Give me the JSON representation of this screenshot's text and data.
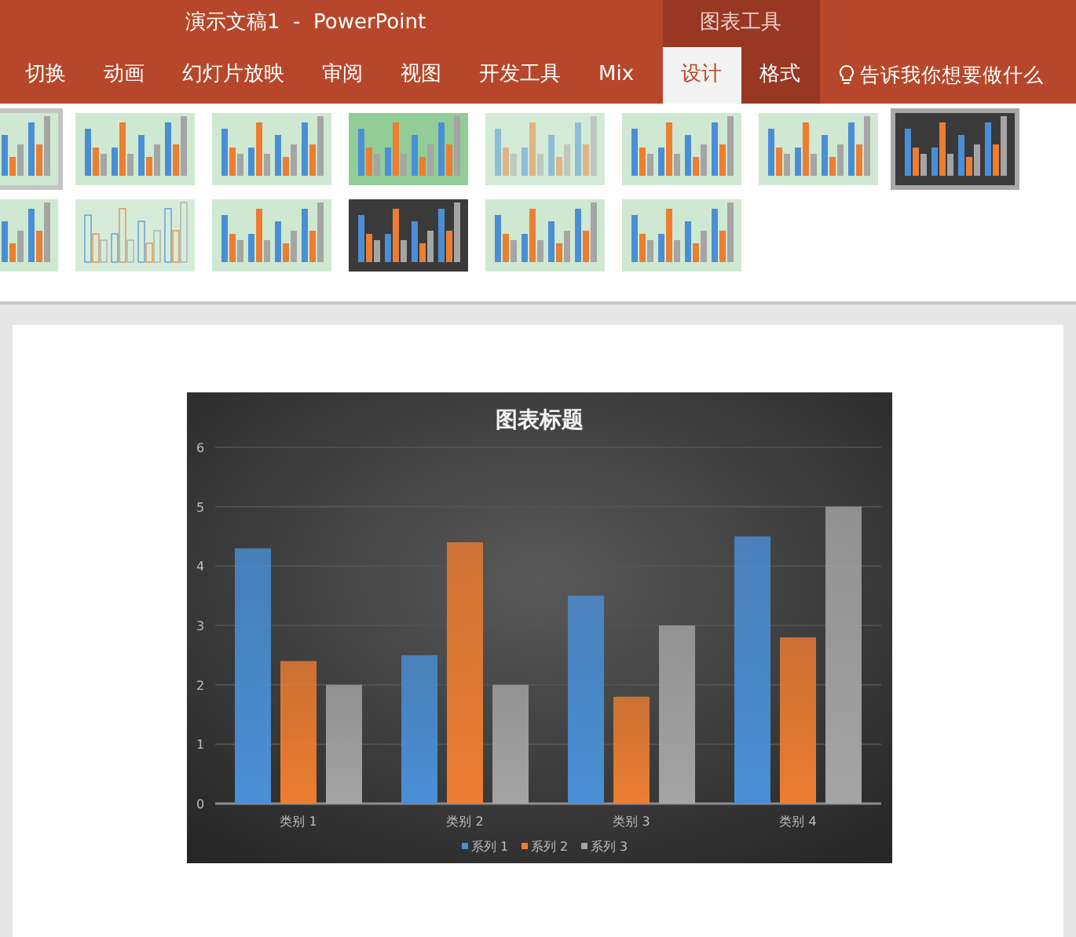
{
  "window": {
    "title": "演示文稿1  -  PowerPoint",
    "context_group": "图表工具"
  },
  "tabs": [
    {
      "label": "切换",
      "selected": false,
      "contextual": false
    },
    {
      "label": "动画",
      "selected": false,
      "contextual": false
    },
    {
      "label": "幻灯片放映",
      "selected": false,
      "contextual": false
    },
    {
      "label": "审阅",
      "selected": false,
      "contextual": false
    },
    {
      "label": "视图",
      "selected": false,
      "contextual": false
    },
    {
      "label": "开发工具",
      "selected": false,
      "contextual": false
    },
    {
      "label": "Mix",
      "selected": false,
      "contextual": false
    },
    {
      "label": "设计",
      "selected": true,
      "contextual": true
    },
    {
      "label": "格式",
      "selected": false,
      "contextual": true
    }
  ],
  "tell_me": {
    "placeholder": "告诉我你想要做什么"
  },
  "style_gallery": {
    "rows": [
      [
        {
          "kind": "light",
          "selected": false,
          "hovered": true
        },
        {
          "kind": "light",
          "selected": false,
          "hovered": false
        },
        {
          "kind": "striped",
          "selected": false,
          "hovered": false
        },
        {
          "kind": "glow",
          "selected": false,
          "hovered": false
        },
        {
          "kind": "pale",
          "selected": false,
          "hovered": false
        },
        {
          "kind": "light",
          "selected": false,
          "hovered": false
        },
        {
          "kind": "light",
          "selected": false,
          "hovered": false
        },
        {
          "kind": "dark",
          "selected": true,
          "hovered": false
        }
      ],
      [
        {
          "kind": "light",
          "selected": false,
          "hovered": false
        },
        {
          "kind": "outline",
          "selected": false,
          "hovered": false
        },
        {
          "kind": "light",
          "selected": false,
          "hovered": false
        },
        {
          "kind": "dark",
          "selected": false,
          "hovered": false
        },
        {
          "kind": "light",
          "selected": false,
          "hovered": false
        },
        {
          "kind": "light",
          "selected": false,
          "hovered": false
        }
      ]
    ]
  },
  "slide": {
    "chart_data": {
      "type": "bar",
      "title": "图表标题",
      "categories": [
        "类别 1",
        "类别 2",
        "类别 3",
        "类别 4"
      ],
      "series": [
        {
          "name": "系列 1",
          "color": "#4a8fd6",
          "values": [
            4.3,
            2.5,
            3.5,
            4.5
          ]
        },
        {
          "name": "系列 2",
          "color": "#ed7d31",
          "values": [
            2.4,
            4.4,
            1.8,
            2.8
          ]
        },
        {
          "name": "系列 3",
          "color": "#a5a5a5",
          "values": [
            2,
            2,
            3,
            5
          ]
        }
      ],
      "grid": true,
      "legend": "bottom",
      "ylim": [
        0,
        6
      ],
      "yticks": [
        0,
        1,
        2,
        3,
        4,
        5,
        6
      ]
    }
  }
}
